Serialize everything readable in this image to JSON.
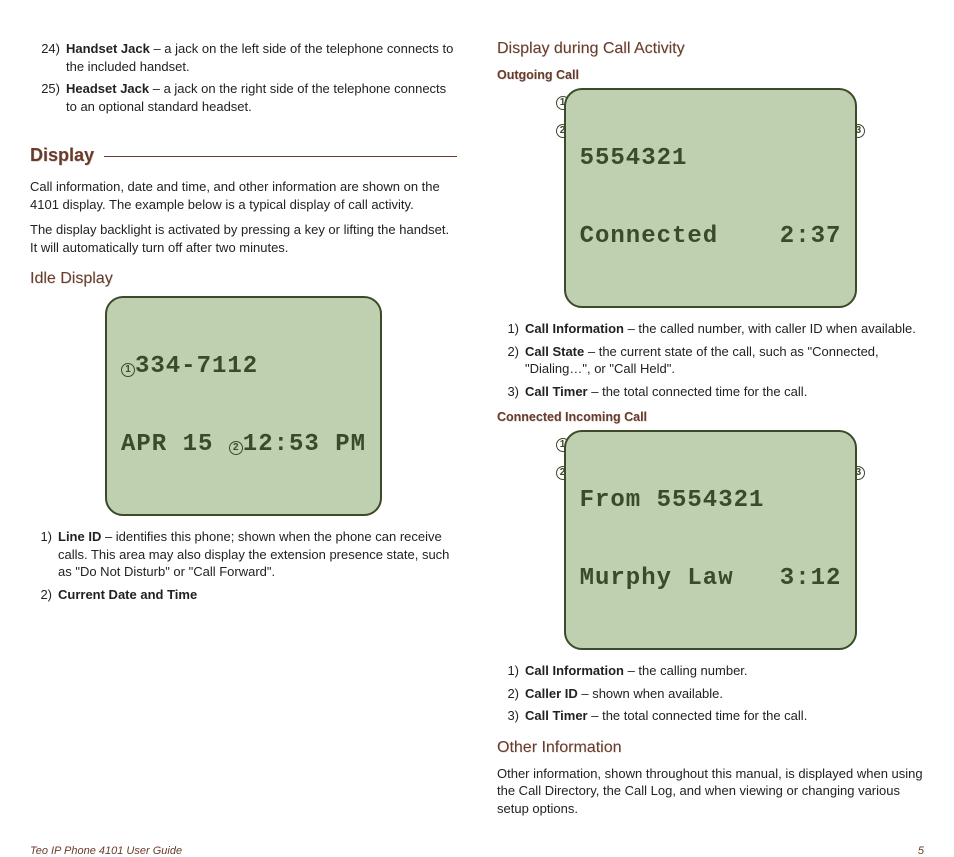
{
  "left": {
    "items24": {
      "num": "24)",
      "title": "Handset Jack",
      "desc": " – a jack on the left side of the telephone connects to the included handset."
    },
    "items25": {
      "num": "25)",
      "title": "Headset Jack",
      "desc": " – a jack on the right side of the telephone connects to an optional standard headset."
    },
    "displayTitle": "Display",
    "displayPara1": "Call information, date and time, and other information are shown on the 4101 display. The example below is a typical display of call activity.",
    "displayPara2": "The display backlight is activated by pressing a key or lifting the handset. It will automatically turn off after two minutes.",
    "idleTitle": "Idle Display",
    "idle_lcd": {
      "line1": "334-7112",
      "line2a": "APR 15 ",
      "line2b": "12:53 PM"
    },
    "idleItems": [
      {
        "num": "1)",
        "title": "Line ID",
        "desc": " – identifies this phone; shown when the phone can receive calls. This area may also display the extension presence state, such as \"Do Not Disturb\" or \"Call Forward\"."
      },
      {
        "num": "2)",
        "title": "Current Date and Time",
        "desc": ""
      }
    ]
  },
  "right": {
    "callActTitle": "Display during Call Activity",
    "outgoingTitle": "Outgoing Call",
    "outgoing_lcd": {
      "line1": "5554321",
      "line2": "Connected    2:37"
    },
    "outgoingItems": [
      {
        "num": "1)",
        "title": "Call Information",
        "desc": " – the called number, with caller ID when available."
      },
      {
        "num": "2)",
        "title": "Call State",
        "desc": " – the current state of the call, such as \"Connected, \"Dialing…\", or \"Call Held\"."
      },
      {
        "num": "3)",
        "title": "Call Timer",
        "desc": " – the total connected time for the call."
      }
    ],
    "incomingTitle": "Connected Incoming Call",
    "incoming_lcd": {
      "line1": "From 5554321",
      "line2": "Murphy Law   3:12"
    },
    "incomingItems": [
      {
        "num": "1)",
        "title": "Call Information",
        "desc": " – the calling number."
      },
      {
        "num": "2)",
        "title": "Caller ID",
        "desc": " – shown when available."
      },
      {
        "num": "3)",
        "title": "Call Timer",
        "desc": " – the total connected time for the call."
      }
    ],
    "otherTitle": "Other Information",
    "otherPara": "Other information, shown throughout this manual, is displayed when using the Call Directory, the Call Log, and when viewing or changing various setup options."
  },
  "footer": {
    "left": "Teo IP Phone 4101 User Guide",
    "right": "5"
  }
}
